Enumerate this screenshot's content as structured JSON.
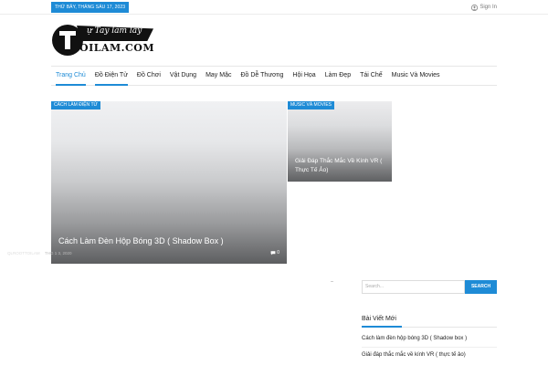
{
  "topbar": {
    "date": "THỨ BẢY, THÁNG SÁU 17, 2023",
    "signin": "Sign In"
  },
  "logo": {
    "top_text": "ự Tay làm lấy",
    "bottom_text": "OILAM.COM"
  },
  "nav": {
    "items": [
      {
        "label": "Trang Chủ"
      },
      {
        "label": "Đồ Điện Tử"
      },
      {
        "label": "Đồ Chơi"
      },
      {
        "label": "Vật Dụng"
      },
      {
        "label": "May Mặc"
      },
      {
        "label": "Đồ Dễ Thương"
      },
      {
        "label": "Hội Họa"
      },
      {
        "label": "Làm Đẹp"
      },
      {
        "label": "Tái Chế"
      },
      {
        "label": "Music Và Movies"
      }
    ]
  },
  "featured": {
    "big": {
      "category": "CÁCH LÀM ĐIỆN TỬ",
      "title": "Cách Làm Đèn Hộp Bóng 3D ( Shadow Box )",
      "author": "QLROOTTOILAM",
      "date": "THG 1 3, 2020",
      "comments": "0"
    },
    "small": {
      "category": "MUSIC VÀ MOVIES",
      "title": "Giải Đáp Thắc Mắc Về Kính VR ( Thực Tế Ảo)"
    }
  },
  "sidebar": {
    "search_placeholder": "Search...",
    "search_button": "SEARCH",
    "recent_heading": "Bài Viết Mới",
    "recent_posts": [
      {
        "title": "Cách làm đèn hộp bóng 3D ( Shadow box )"
      },
      {
        "title": "Giải đáp thắc mắc về kính VR ( thực tế ảo)"
      }
    ]
  },
  "colors": {
    "accent": "#1e8bd6"
  }
}
